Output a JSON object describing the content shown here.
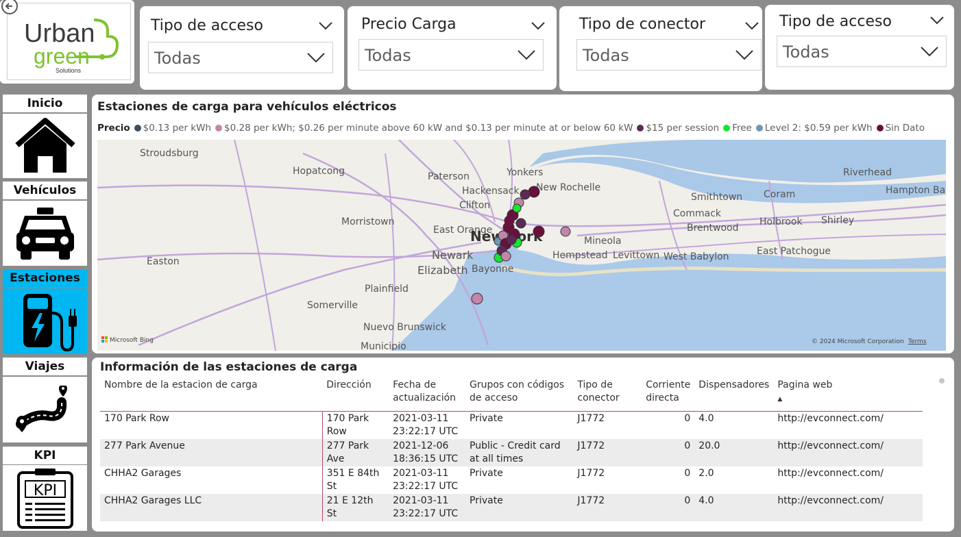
{
  "logo": {
    "line1": "Urban",
    "line2": "green",
    "line3": "Solutions"
  },
  "slicers": [
    {
      "title": "Tipo de acceso",
      "value": "Todas"
    },
    {
      "title": "Precio Carga",
      "value": "Todas"
    },
    {
      "title": "Tipo de conector",
      "value": "Todas"
    },
    {
      "title": "Tipo de acceso",
      "value": "Todas"
    }
  ],
  "nav": [
    {
      "label": "Inicio",
      "icon": "home-icon",
      "active": false
    },
    {
      "label": "Vehículos",
      "icon": "car-icon",
      "active": false
    },
    {
      "label": "Estaciones",
      "icon": "charging-station-icon",
      "active": true
    },
    {
      "label": "Viajes",
      "icon": "route-icon",
      "active": false
    },
    {
      "label": "KPI",
      "icon": "kpi-clipboard-icon",
      "active": false
    }
  ],
  "map_visual": {
    "title": "Estaciones de carga para vehículos eléctricos",
    "legend_title": "Precio",
    "legend": [
      {
        "label": "$0.13 per kWh",
        "color": "#3d4f63"
      },
      {
        "label": "$0.28 per kWh; $0.26 per minute above 60 kW and $0.13 per minute at or below 60 kW",
        "color": "#c286a8"
      },
      {
        "label": "$15 per session",
        "color": "#5b2a55"
      },
      {
        "label": "Free",
        "color": "#16e630"
      },
      {
        "label": "Level 2: $0.59 per kWh",
        "color": "#6f96b4"
      },
      {
        "label": "Sin Dato",
        "color": "#6b0f3c"
      }
    ],
    "place_labels": [
      "Stroudsburg",
      "Hopatcong",
      "Paterson",
      "Yonkers",
      "Hackensack",
      "New Rochelle",
      "Clifton",
      "Riverhead",
      "Hampton Bays",
      "Smithtown",
      "Coram",
      "Commack",
      "Shirley",
      "Brentwood",
      "Holbrook",
      "Morristown",
      "East Orange",
      "New York",
      "Mineola",
      "East Patchogue",
      "West Babylon",
      "Newark",
      "Hempstead",
      "Levittown",
      "Easton",
      "Elizabeth",
      "Bayonne",
      "Plainfield",
      "Somerville",
      "Nuevo Brunswick",
      "Municipio"
    ],
    "attribution_left": "Microsoft Bing",
    "attribution_right": "© 2024 Microsoft Corporation",
    "terms": "Terms"
  },
  "table": {
    "title": "Información de las estaciones de carga",
    "columns": [
      "Nombre de la estacion de carga",
      "Dirección",
      "Fecha de actualización",
      "Grupos con códigos de acceso",
      "Tipo de conector",
      "Corriente directa",
      "Dispensadores",
      "Pagina web"
    ],
    "rows": [
      [
        "170 Park Row",
        "170 Park Row",
        "2021-03-11 23:22:17 UTC",
        "Private",
        "J1772",
        "0",
        "4.0",
        "http://evconnect.com/"
      ],
      [
        "277 Park Avenue",
        "277 Park Ave",
        "2021-12-06 18:36:15 UTC",
        "Public - Credit card at all times",
        "J1772",
        "0",
        "20.0",
        "http://evconnect.com/"
      ],
      [
        "CHHA2 Garages",
        "351 E 84th St",
        "2021-03-11 23:22:17 UTC",
        "Private",
        "J1772",
        "0",
        "2.0",
        "http://evconnect.com/"
      ],
      [
        "CHHA2 Garages LLC",
        "21 E 12th St",
        "2021-03-11 23:22:17 UTC",
        "Private",
        "J1772",
        "0",
        "4.0",
        "http://evconnect.com/"
      ]
    ]
  }
}
